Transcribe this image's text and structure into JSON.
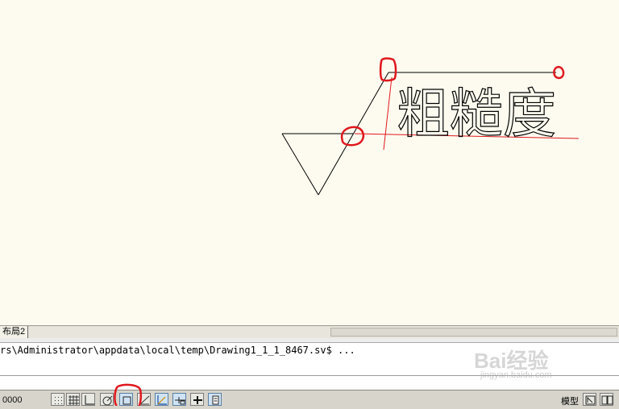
{
  "canvas": {
    "drawing_text": "粗糙度",
    "background": "#fdfbef",
    "annotation_color": "#e0181e"
  },
  "layout_tabs": {
    "items": [
      "布局2"
    ]
  },
  "command": {
    "history_line": "rs\\Administrator\\appdata\\local\\temp\\Drawing1_1_1_8467.sv$ ...",
    "input_value": ""
  },
  "status_bar": {
    "coordinates": "0000",
    "model_label": "模型",
    "toggles": [
      {
        "icon": "snap-icon",
        "on": false
      },
      {
        "icon": "grid-icon",
        "on": false
      },
      {
        "icon": "ortho-icon",
        "on": false
      },
      {
        "icon": "polar-icon",
        "on": false
      },
      {
        "icon": "object-snap-icon",
        "on": true
      },
      {
        "icon": "object-track-icon",
        "on": false
      },
      {
        "icon": "dynamic-ucs-icon",
        "on": true
      },
      {
        "icon": "dynamic-input-icon",
        "on": true
      },
      {
        "icon": "lineweight-icon",
        "on": false
      },
      {
        "icon": "quick-properties-icon",
        "on": true
      }
    ]
  },
  "watermark": {
    "brand": "Bai经验",
    "url": "jingyan.baidu.com"
  }
}
